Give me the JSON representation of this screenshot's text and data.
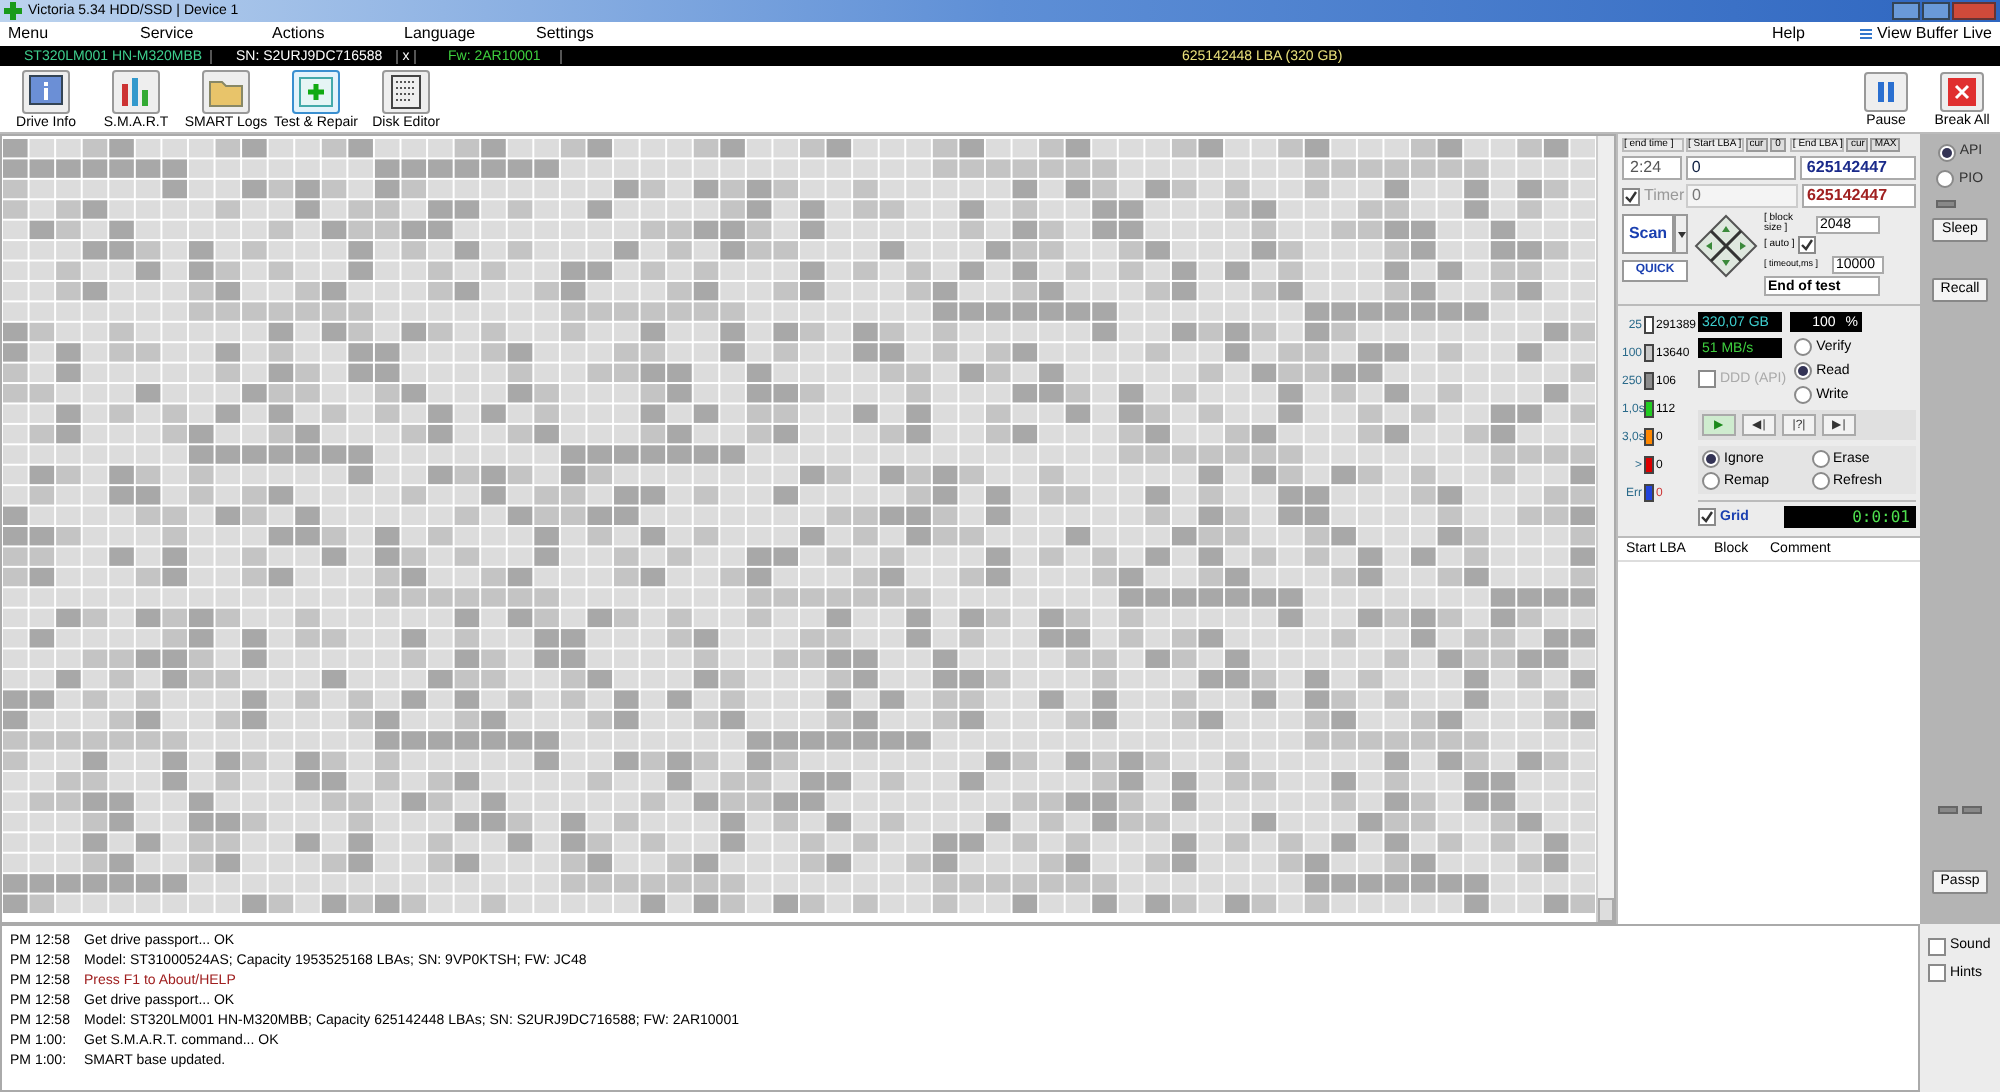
{
  "window": {
    "title": "Victoria 5.34 HDD/SSD | Device 1"
  },
  "menu": {
    "left": [
      "Menu",
      "Service",
      "Actions",
      "Language",
      "Settings"
    ],
    "right": [
      "Help",
      "View Buffer Live"
    ]
  },
  "drive_bar": {
    "model": "ST320LM001 HN-M320MBB",
    "serial": "SN: S2URJ9DC716588",
    "close": "x",
    "firmware": "Fw: 2AR10001",
    "capacity": "625142448 LBA (320 GB)"
  },
  "toolbar": [
    {
      "label": "Drive Info",
      "kind": "info",
      "selected": false
    },
    {
      "label": "S.M.A.R.T",
      "kind": "smart",
      "selected": false
    },
    {
      "label": "SMART Logs",
      "kind": "logs",
      "selected": false
    },
    {
      "label": "Test & Repair",
      "kind": "test",
      "selected": true
    },
    {
      "label": "Disk Editor",
      "kind": "editor",
      "selected": false
    }
  ],
  "toolbar_right": [
    {
      "label": "Pause",
      "kind": "pause"
    },
    {
      "label": "Break All",
      "kind": "break"
    }
  ],
  "test": {
    "end_time_label": "[ end time ]",
    "start_lba_label": "[ Start LBA ]",
    "start_cur": "cur",
    "start_zero": "0",
    "end_lba_label": "[ End LBA ]",
    "end_cur": "cur",
    "end_max": "MAX",
    "end_time": "2:24",
    "start_lba": "0",
    "end_lba": "625142447",
    "timer_label": "Timer",
    "timer_checked": true,
    "timer_value": "0",
    "end_lba_current": "625142447",
    "scan": "Scan",
    "quick": "QUICK",
    "block_size_label": "[ block size ]",
    "block_size": "2048",
    "auto_label": "[ auto ]",
    "auto_checked": true,
    "timeout_label": "[ timeout,ms ]",
    "timeout": "10000",
    "end_action": "End of test"
  },
  "legend": [
    {
      "label": "25",
      "count": "291389",
      "color": "#ffffff"
    },
    {
      "label": "100",
      "count": "13640",
      "color": "#c8c8c8"
    },
    {
      "label": "250",
      "count": "106",
      "color": "#8c8c8c"
    },
    {
      "label": "1,0s",
      "count": "112",
      "color": "#22cc22"
    },
    {
      "label": "3,0s",
      "count": "0",
      "color": "#ff8800"
    },
    {
      "label": ">",
      "count": "0",
      "color": "#dd0000"
    },
    {
      "label": "Err",
      "count": "0",
      "color": "#2244dd"
    }
  ],
  "status": {
    "size": "320,07 GB",
    "percent": "100",
    "percent_sign": "%",
    "speed": "51 MB/s",
    "ddd_label": "DDD (API)",
    "ddd_checked": false
  },
  "modes": [
    {
      "label": "Verify",
      "selected": false
    },
    {
      "label": "Read",
      "selected": true
    },
    {
      "label": "Write",
      "selected": false
    }
  ],
  "play": [
    {
      "kind": "play",
      "label": "▶"
    },
    {
      "kind": "back",
      "label": "◀|"
    },
    {
      "kind": "skip",
      "label": "|?|"
    },
    {
      "kind": "end",
      "label": "▶|"
    }
  ],
  "actions": [
    {
      "label": "Ignore",
      "selected": true
    },
    {
      "label": "Erase",
      "selected": false
    },
    {
      "label": "Remap",
      "selected": false
    },
    {
      "label": "Refresh",
      "selected": false
    }
  ],
  "grid_label": "Grid",
  "grid_checked": true,
  "elapsed": "0:0:01",
  "table": {
    "columns": [
      "Start LBA",
      "Block",
      "Comment"
    ]
  },
  "side": {
    "ports": [
      {
        "label": "API",
        "selected": true
      },
      {
        "label": "PIO",
        "selected": false
      }
    ],
    "buttons": [
      "Sleep",
      "Recall",
      "Passp"
    ],
    "options": [
      {
        "label": "Sound",
        "checked": false
      },
      {
        "label": "Hints",
        "checked": false
      }
    ]
  },
  "log": [
    {
      "time": "PM 12:58",
      "text": "Get drive passport... OK",
      "kind": "info"
    },
    {
      "time": "PM 12:58",
      "text": "Model: ST31000524AS; Capacity 1953525168 LBAs; SN: 9VP0KTSH; FW: JC48",
      "kind": "info"
    },
    {
      "time": "PM 12:58",
      "text": "Press F1 to About/HELP",
      "kind": "hint"
    },
    {
      "time": "PM 12:58",
      "text": "Get drive passport... OK",
      "kind": "info"
    },
    {
      "time": "PM 12:58",
      "text": "Model: ST320LM001 HN-M320MBB; Capacity 625142448 LBAs; SN: S2URJ9DC716588; FW: 2AR10001",
      "kind": "info"
    },
    {
      "time": "PM 1:00:",
      "text": "Get S.M.A.R.T. command... OK",
      "kind": "info"
    },
    {
      "time": "PM 1:00:",
      "text": "SMART base updated.",
      "kind": "info"
    }
  ]
}
